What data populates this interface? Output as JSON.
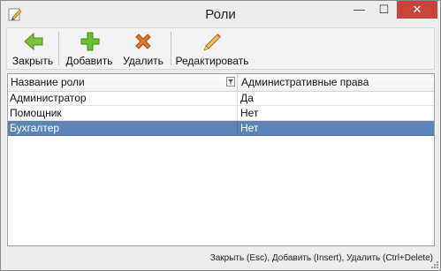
{
  "window": {
    "title": "Роли",
    "controls": {
      "minimize": "—",
      "maximize": "☐",
      "close": "✕"
    }
  },
  "toolbar": {
    "close_label": "Закрыть",
    "add_label": "Добавить",
    "delete_label": "Удалить",
    "edit_label": "Редактировать"
  },
  "grid": {
    "columns": [
      "Название роли",
      "Административные права"
    ],
    "rows": [
      {
        "role": "Администратор",
        "admin": "Да",
        "selected": false
      },
      {
        "role": "Помощник",
        "admin": "Нет",
        "selected": false
      },
      {
        "role": "Бухгалтер",
        "admin": "Нет",
        "selected": true
      }
    ]
  },
  "statusbar": {
    "hint": "Закрыть (Esc), Добавить (Insert), Удалить (Ctrl+Delete)"
  },
  "colors": {
    "selection": "#5d84b4",
    "close_button": "#c7463b",
    "add_icon": "#6cbf2f",
    "delete_icon": "#e07a2a"
  }
}
